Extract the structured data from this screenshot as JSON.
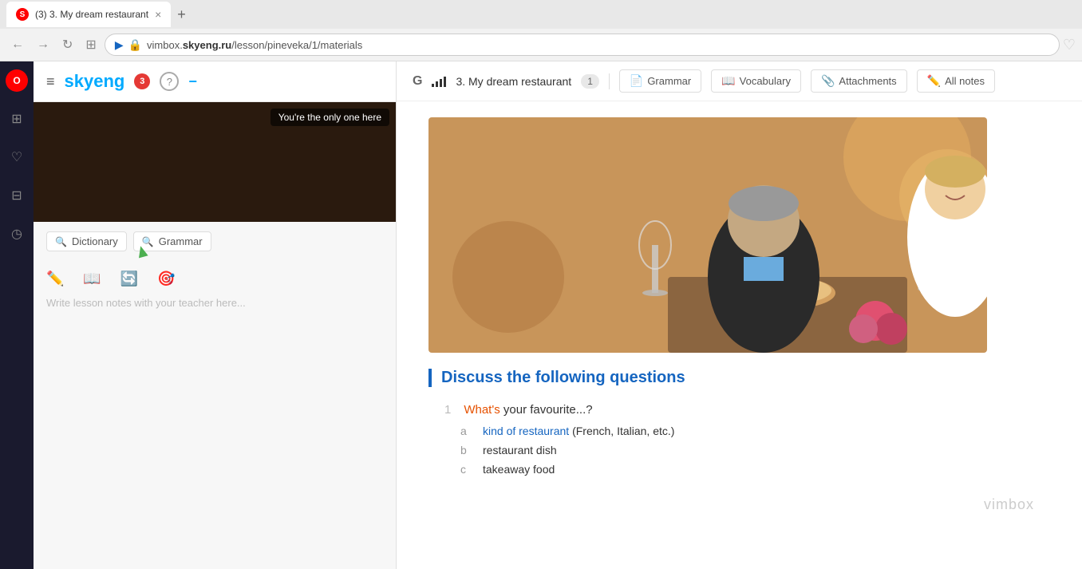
{
  "browser": {
    "tab_favicon": "S",
    "tab_title": "(3) 3. My dream restaurant",
    "tab_close": "×",
    "new_tab": "+",
    "address": "vimbox.",
    "domain": "skyeng.ru",
    "address_path": "/lesson/pineveka/1/materials",
    "address_full": "vimbox.skyeng.ru/lesson/pineveka/1/materials"
  },
  "sidebar_icons": [
    "☰",
    "⊞",
    "♡",
    "⊟",
    "◷"
  ],
  "left_panel": {
    "hamburger": "≡",
    "logo": "skyeng",
    "notification_count": "3",
    "help": "?",
    "minimize": "−",
    "video_tooltip": "You're the only one here",
    "dict_tab_label": "Dictionary",
    "grammar_tab_label": "Grammar",
    "notes_placeholder": "Write lesson notes with your teacher here..."
  },
  "toolbar": {
    "g_label": "G",
    "lesson_title": "3. My dream restaurant",
    "lesson_badge": "1",
    "btn_grammar": "Grammar",
    "btn_vocabulary": "Vocabulary",
    "btn_attachments": "Attachments",
    "btn_all_notes": "All notes"
  },
  "content": {
    "discuss_title": "Discuss the following questions",
    "question_number": "1",
    "question_prefix": "What's your favourite...?",
    "sub_items": [
      {
        "label": "a",
        "text": "kind of restaurant (French, Italian, etc.)"
      },
      {
        "label": "b",
        "text": "restaurant dish"
      },
      {
        "label": "c",
        "text": "takeaway food"
      }
    ]
  },
  "watermark": "vimbox"
}
